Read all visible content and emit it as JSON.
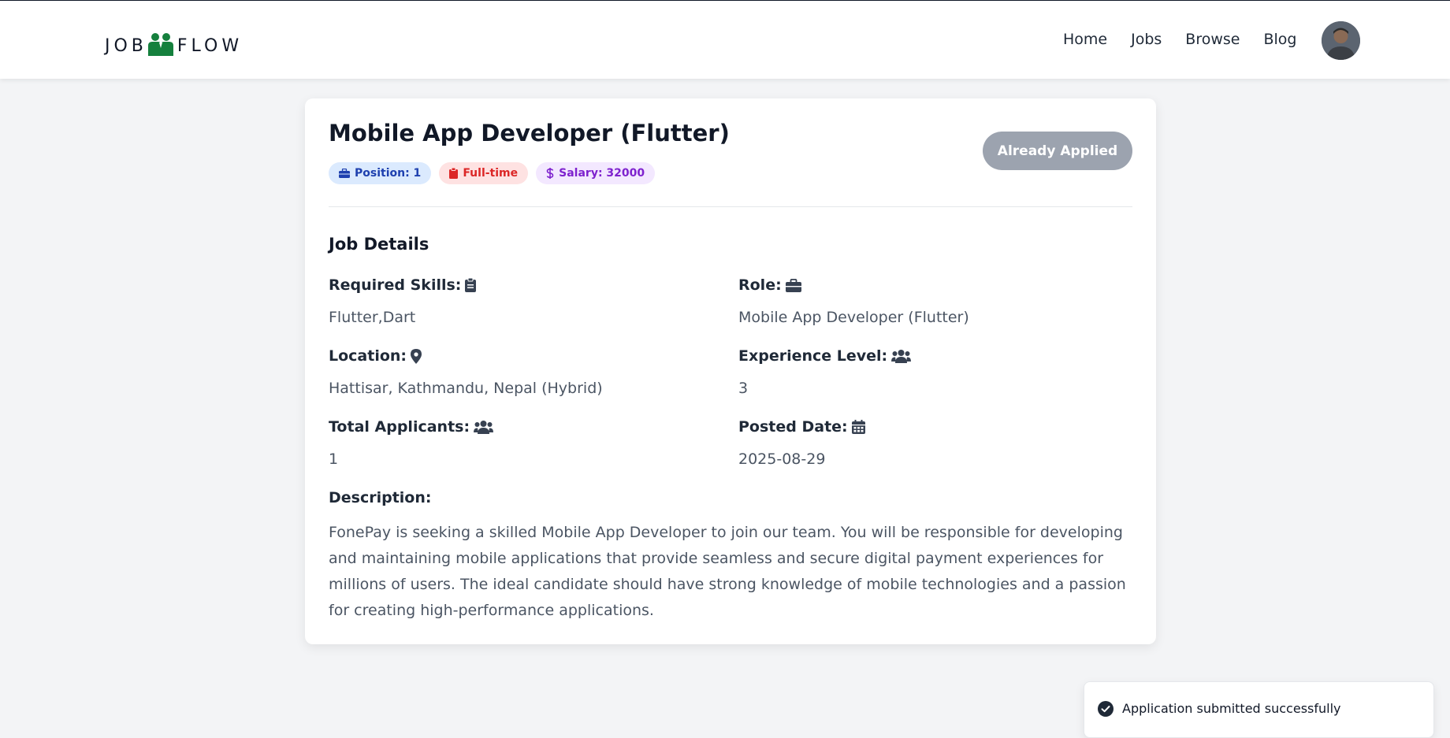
{
  "header": {
    "logo_left": "JOB",
    "logo_right": "FLOW",
    "nav": [
      "Home",
      "Jobs",
      "Browse",
      "Blog"
    ]
  },
  "job": {
    "title": "Mobile App Developer (Flutter)",
    "badges": {
      "position": "Position: 1",
      "type": "Full-time",
      "salary": "Salary: 32000"
    },
    "apply_button": "Already Applied",
    "section_title": "Job Details",
    "fields": {
      "skills_label": "Required Skills:",
      "skills_value": "Flutter,Dart",
      "role_label": "Role:",
      "role_value": "Mobile App Developer (Flutter)",
      "location_label": "Location:",
      "location_value": "Hattisar, Kathmandu, Nepal (Hybrid)",
      "experience_label": "Experience Level:",
      "experience_value": "3",
      "applicants_label": "Total Applicants:",
      "applicants_value": "1",
      "posted_label": "Posted Date:",
      "posted_value": "2025-08-29"
    },
    "description_label": "Description:",
    "description": "FonePay is seeking a skilled Mobile App Developer to join our team. You will be responsible for developing and maintaining mobile applications that provide seamless and secure digital payment experiences for millions of users. The ideal candidate should have strong knowledge of mobile technologies and a passion for creating high-performance applications."
  },
  "toast": {
    "message": "Application submitted successfully",
    "icon": "check-circle-icon"
  },
  "colors": {
    "logo_green": "#15803d",
    "badge_blue": "#1e40af",
    "badge_red": "#dc2626",
    "badge_purple": "#7e22ce",
    "disabled_button": "#9ca3af"
  }
}
